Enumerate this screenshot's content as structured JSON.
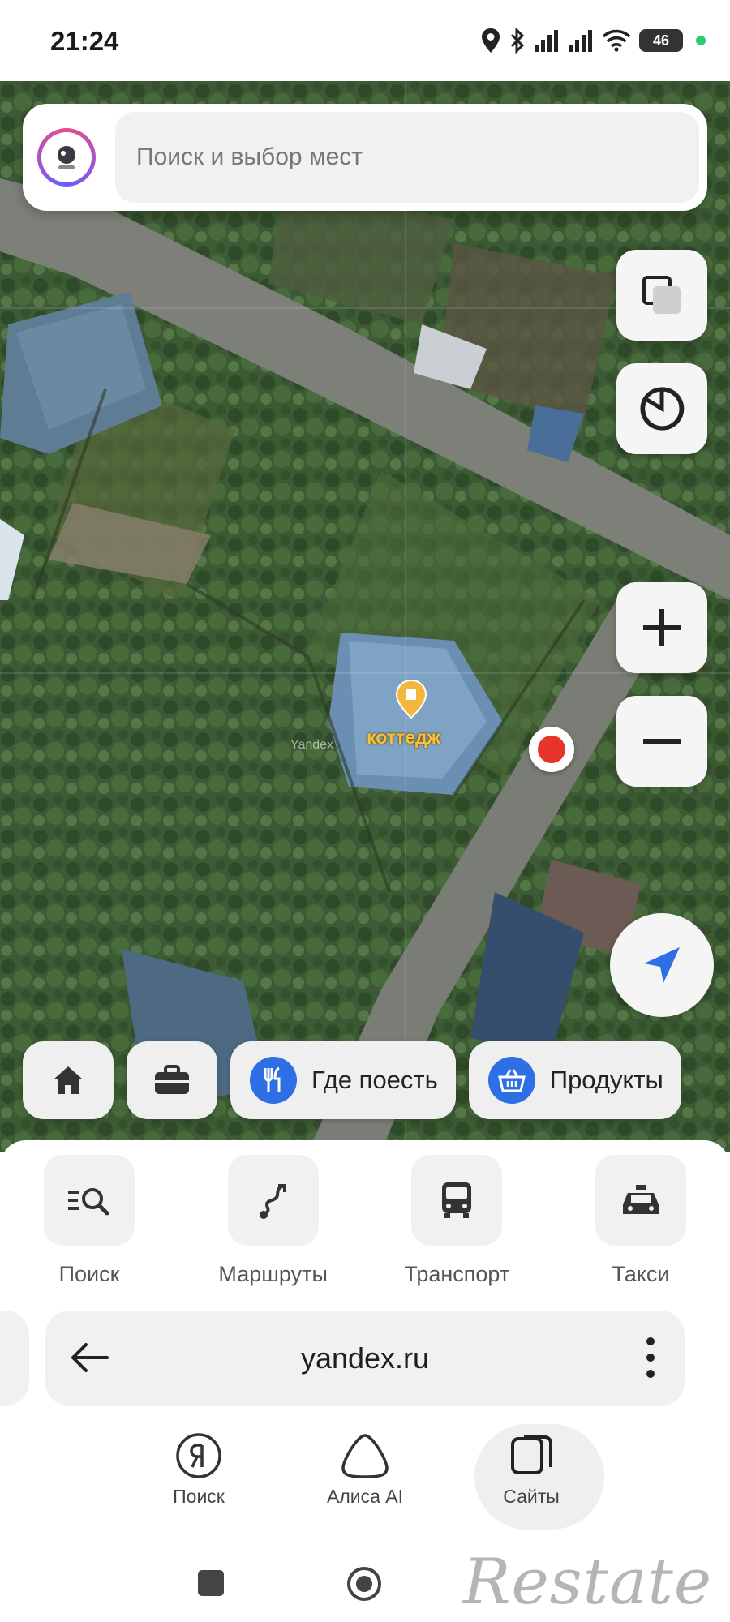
{
  "status": {
    "time": "21:24",
    "battery": "46",
    "icons": [
      "location-icon",
      "bluetooth-icon",
      "signal-icon",
      "signal-icon",
      "wifi-icon",
      "battery-icon"
    ]
  },
  "search": {
    "placeholder": "Поиск и выбор мест"
  },
  "map": {
    "poi_label": "коттедж",
    "watermark": "Yandex",
    "buttons": [
      "layers-icon",
      "compass-icon",
      "zoom-in-icon",
      "zoom-out-icon",
      "my-location-icon"
    ]
  },
  "chips": [
    {
      "icon": "home-icon",
      "label": ""
    },
    {
      "icon": "briefcase-icon",
      "label": ""
    },
    {
      "icon": "fork-knife-icon",
      "label": "Где поесть"
    },
    {
      "icon": "basket-icon",
      "label": "Продукты"
    }
  ],
  "quick_actions": [
    {
      "icon": "search-list-icon",
      "label": "Поиск"
    },
    {
      "icon": "route-icon",
      "label": "Маршруты"
    },
    {
      "icon": "bus-icon",
      "label": "Транспорт"
    },
    {
      "icon": "taxi-icon",
      "label": "Такси"
    }
  ],
  "browser": {
    "url": "yandex.ru",
    "nav": [
      {
        "icon": "yandex-icon",
        "label": "Поиск"
      },
      {
        "icon": "alice-icon",
        "label": "Алиса AI"
      },
      {
        "icon": "sites-icon",
        "label": "Сайты",
        "active": true
      }
    ]
  },
  "watermarks": {
    "bottom_right": "Restate"
  },
  "colors": {
    "accent_blue": "#2f6fe6",
    "location_red": "#e8352b",
    "poi_yellow": "#f4c23c"
  }
}
